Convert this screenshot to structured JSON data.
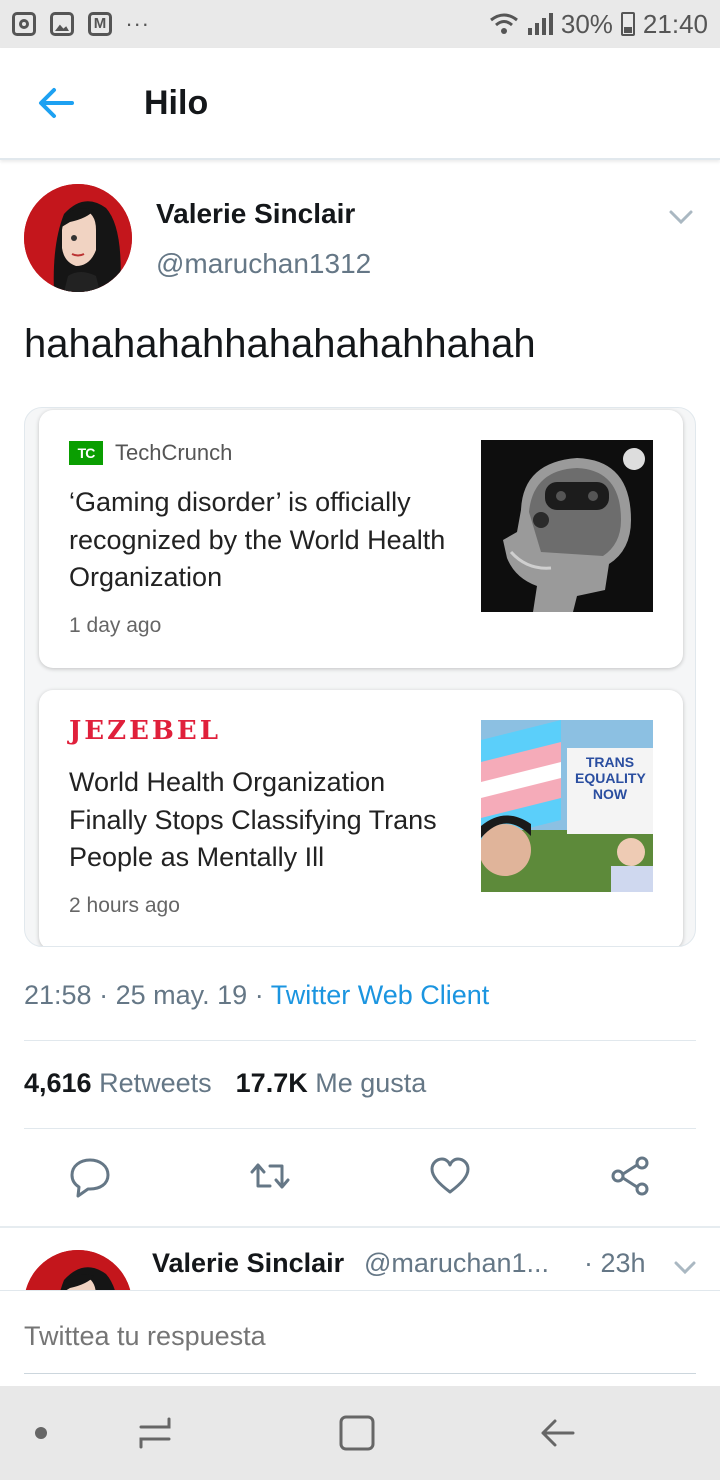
{
  "status_bar": {
    "battery": "30%",
    "time": "21:40"
  },
  "header": {
    "title": "Hilo"
  },
  "tweet": {
    "author_name": "Valerie Sinclair",
    "handle": "@maruchan1312",
    "text": "hahahahahhahahahahhahah",
    "time": "21:58",
    "date": "25 may. 19",
    "client": "Twitter Web Client",
    "retweets_count": "4,616",
    "retweets_label": "Retweets",
    "likes_count": "17.7K",
    "likes_label": "Me gusta"
  },
  "cards": [
    {
      "source_logo": "TC",
      "source": "TechCrunch",
      "title": "‘Gaming disorder’ is officially recognized by the World Health Organization",
      "time": "1 day ago"
    },
    {
      "source": "JEZEBEL",
      "title": "World Health Organization Finally Stops Classifying Trans People as Mentally Ill",
      "time": "2 hours ago",
      "sign_text": "TRANS EQUALITY NOW"
    }
  ],
  "reply": {
    "author_name": "Valerie Sinclair",
    "handle": "@maruchan1...",
    "time": "· 23h"
  },
  "composer": {
    "placeholder": "Twittea tu respuesta"
  },
  "colors": {
    "twitter_blue": "#1b95e0",
    "text": "#14171a",
    "secondary": "#657786",
    "avatar_red": "#c4161c",
    "techcrunch_green": "#0a9e01",
    "jezebel_red": "#e0203b"
  },
  "icons": [
    "instagram-icon",
    "gallery-icon",
    "mail-icon",
    "wifi-icon",
    "signal-icon",
    "battery-icon",
    "back-arrow-icon",
    "chevron-down-icon",
    "reply-icon",
    "retweet-icon",
    "like-icon",
    "share-icon",
    "home-dot-icon",
    "recent-apps-icon",
    "home-button-icon",
    "back-icon"
  ]
}
